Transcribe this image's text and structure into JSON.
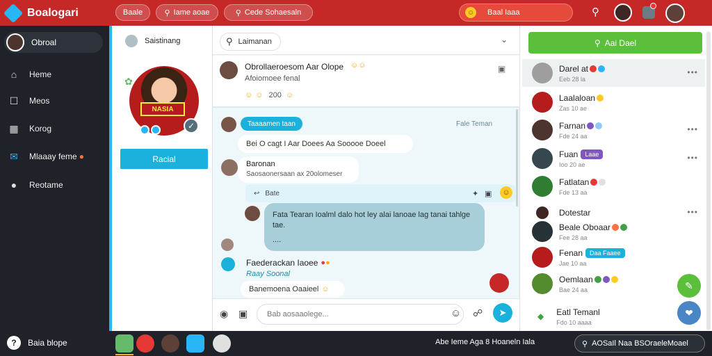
{
  "app": {
    "name": "Boalogari"
  },
  "header": {
    "pills": [
      {
        "label": "Baale"
      },
      {
        "label": "Iame aoae"
      },
      {
        "label": "Cede Sohaesaln"
      }
    ],
    "search_label": "Baal Iaaa"
  },
  "sidebar": {
    "user_name": "Obroal",
    "items": [
      {
        "label": "Heme"
      },
      {
        "label": "Meos"
      },
      {
        "label": "Korog"
      },
      {
        "label": "Mlaaay feme"
      },
      {
        "label": "Reotame"
      }
    ],
    "help_label": "Baia blope"
  },
  "profile": {
    "banner_text": "NASIA",
    "button_label": "Racial"
  },
  "chat": {
    "header": {
      "user_label": "Saistinang",
      "search_label": "Laimanan"
    },
    "post": {
      "title": "Obrollaeroesom Aar Olope",
      "subtitle": "Afoiomoee fenal",
      "count": "200"
    },
    "messages": [
      {
        "tag": "Taaaamen taan",
        "meta": "Fale Teman",
        "text": "Bei O cagt  I Aar Doees Aa Sooooe Doeel"
      },
      {
        "author": "Baronan",
        "text": "Saosaonersaan ax 20olomeser"
      },
      {
        "quote_label": "Bate"
      },
      {
        "text": "Fata Tearan  Ioalml dalo hot ley alai lanoae lag tanai tahlge  tae.",
        "dots": "...."
      },
      {
        "author": "Faederackan Iaoee",
        "sub_author": "Raay Soonal",
        "text": "Banemoena Oaaieel"
      }
    ],
    "composer_placeholder": "Bab aosaaolege..."
  },
  "contacts": {
    "new_button": "Aai Dael",
    "items": [
      {
        "name": "Darel at",
        "sub": "Eeb 28 la"
      },
      {
        "name": "Laalaloan",
        "sub": "Zas 10 ae"
      },
      {
        "name": "Farnan",
        "sub": "Fde 24 aa"
      },
      {
        "name": "Fuan",
        "sub": "Ioo 20 ae",
        "tag": "Laae"
      },
      {
        "name": "Fatlatan",
        "sub": "Fde 13 aa"
      },
      {
        "name": "Dotestar",
        "sub": ""
      },
      {
        "name": "Beale Oboaar",
        "sub": "Fee 28 aa"
      },
      {
        "name": "Fenan",
        "sub": "Jae 10 aa",
        "tag": "Daa Faaee"
      },
      {
        "name": "Oemlaan",
        "sub": "Bae 24 aa"
      },
      {
        "name": "Eatl Temanl",
        "sub": "Fdo 10 aaaa"
      }
    ]
  },
  "bottom": {
    "status": "Abe Ieme Aga 8  Hoaneln Iala",
    "search_label": "AOSaIl Naa BSOraeleMoael"
  },
  "colors": {
    "topbar": "#c62828",
    "sidebar": "#1f2229",
    "accent": "#1ab2dc",
    "green": "#5bbf3b"
  }
}
